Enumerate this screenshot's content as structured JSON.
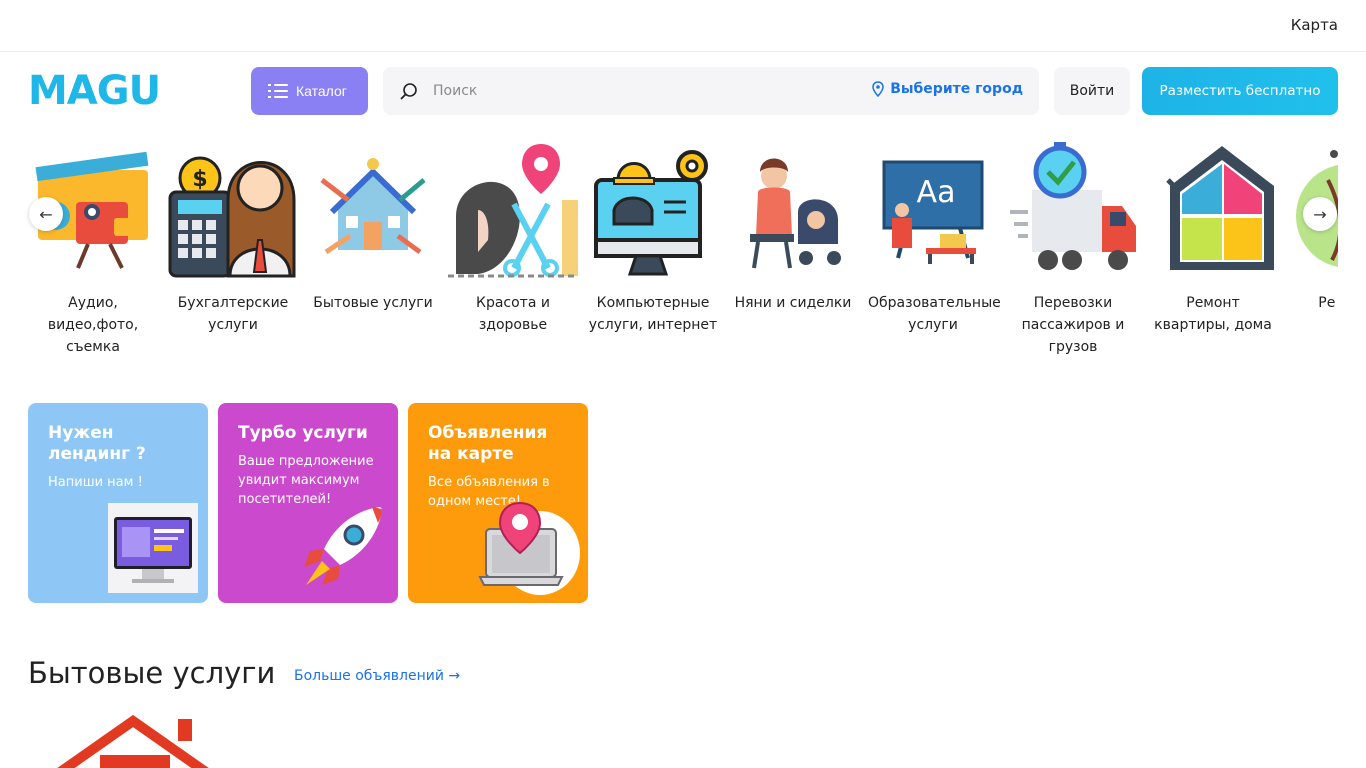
{
  "topbar": {
    "map_label": "Карта"
  },
  "header": {
    "logo": "MAGU",
    "catalog_label": "Каталог",
    "search_placeholder": "Поиск",
    "city_label": "Выберите город",
    "login_label": "Войти",
    "post_label": "Разместить бесплатно"
  },
  "categories": [
    {
      "label": "Аудио, видео,фото, съемка",
      "icon": "film-camera-icon"
    },
    {
      "label": "Бухгалтерские услуги",
      "icon": "accountant-icon"
    },
    {
      "label": "Бытовые услуги",
      "icon": "house-tools-icon"
    },
    {
      "label": "Красота и здоровье",
      "icon": "beauty-icon"
    },
    {
      "label": "Компьютерные услуги, интернет",
      "icon": "computer-service-icon"
    },
    {
      "label": "Няни и сиделки",
      "icon": "nanny-icon"
    },
    {
      "label": "Образовательные услуги",
      "icon": "education-icon"
    },
    {
      "label": "Перевозки пассажиров и грузов",
      "icon": "truck-icon"
    },
    {
      "label": "Ремонт квартиры, дома",
      "icon": "house-repair-icon"
    },
    {
      "label": "Ре пошив",
      "icon": "sewing-icon"
    }
  ],
  "promos": [
    {
      "title": "Нужен лендинг ?",
      "text": "Напиши нам !",
      "color": "#8ec7f5"
    },
    {
      "title": "Турбо услуги",
      "text": "Ваше предложение увидит максимум посетителей!",
      "color": "#cb49cc"
    },
    {
      "title": "Объявления на карте",
      "text": "Все объявления в одном месте!",
      "color": "#fd9b0c"
    }
  ],
  "section": {
    "title": "Бытовые услуги",
    "more_label": "Больше объявлений →"
  },
  "colors": {
    "accent": "#1fb6e8",
    "catalog": "#8a7ff3",
    "link": "#1a73e8"
  }
}
